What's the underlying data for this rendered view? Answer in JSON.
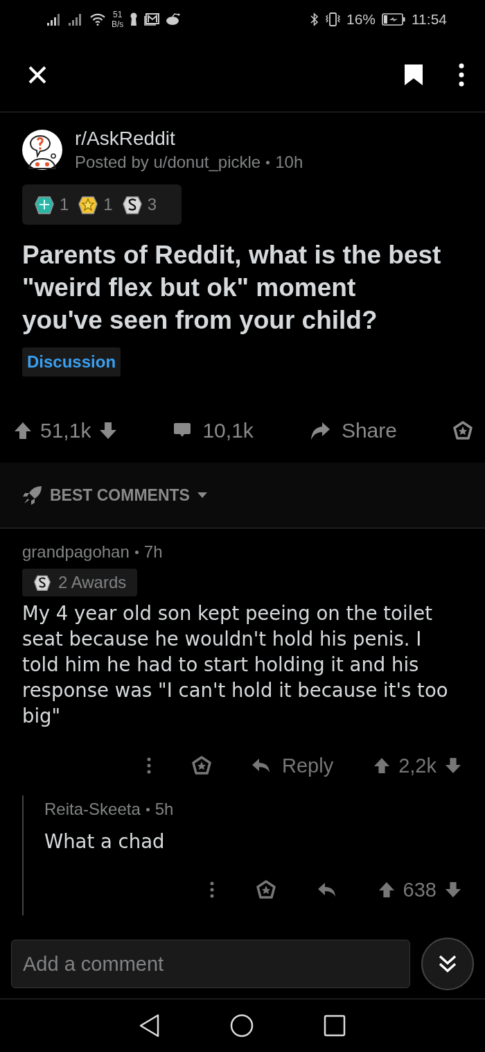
{
  "status_bar": {
    "net_speed": "51",
    "net_unit": "B/s",
    "battery": "16%",
    "time": "11:54"
  },
  "post": {
    "subreddit": "r/AskReddit",
    "posted_by": "Posted by u/donut_pickle",
    "time": "10h",
    "awards": [
      {
        "kind": "teal",
        "count": "1"
      },
      {
        "kind": "gold",
        "count": "1"
      },
      {
        "kind": "silver",
        "count": "3"
      }
    ],
    "title": "Parents of Reddit, what is the best \"weird flex but ok\" moment you've seen from your child?",
    "flair": "Discussion",
    "votes": "51,1k",
    "comments": "10,1k",
    "share": "Share"
  },
  "sort": {
    "label": "BEST COMMENTS"
  },
  "comments": [
    {
      "author": "grandpagohan",
      "time": "7h",
      "awards": "2 Awards",
      "body": "My 4 year old son kept peeing on the toilet seat because he wouldn't hold his penis. I told him he had to start holding it and his response was \"I can't hold it because it's too big\"",
      "reply_label": "Reply",
      "votes": "2,2k",
      "replies": [
        {
          "author": "Reita-Skeeta",
          "time": "5h",
          "body": "What a chad",
          "votes": "638"
        }
      ]
    }
  ],
  "comment_box": {
    "placeholder": "Add a comment"
  }
}
